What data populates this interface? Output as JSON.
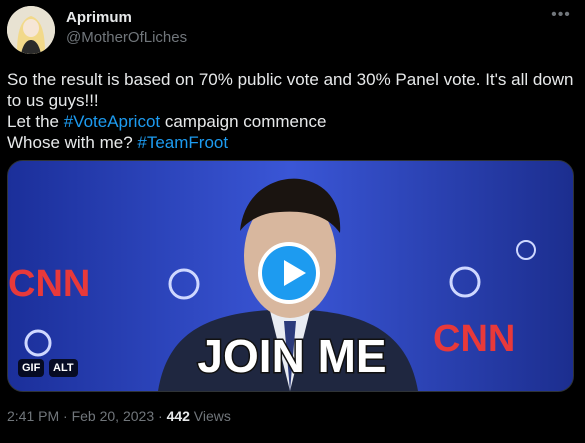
{
  "author": {
    "display_name": "Aprimum",
    "handle": "@MotherOfLiches"
  },
  "tweet": {
    "line1": "So the result is based on 70% public vote and 30% Panel vote. It's all down to us guys!!!",
    "line2_prefix": "Let the ",
    "hashtag1": "#VoteApricot",
    "line2_suffix": " campaign commence",
    "line3_prefix": "Whose with me? ",
    "hashtag2": "#TeamFroot"
  },
  "media": {
    "caption": "JOIN ME",
    "logo_text": "CNN",
    "badge_gif": "GIF",
    "badge_alt": "ALT"
  },
  "meta": {
    "time": "2:41 PM",
    "separator": " · ",
    "date": "Feb 20, 2023",
    "views_count": "442",
    "views_label": " Views"
  },
  "icons": {
    "more": "ellipsis-icon",
    "play": "play-icon"
  },
  "colors": {
    "background": "#000000",
    "hashtag": "#1d9bf0",
    "muted": "#71767b"
  }
}
